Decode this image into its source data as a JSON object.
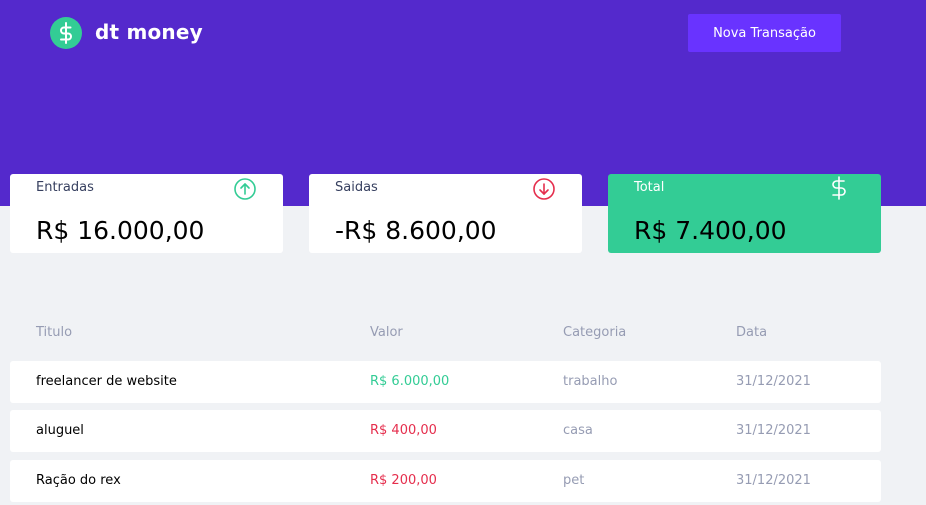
{
  "header": {
    "logo_icon": "dollar-sign-icon",
    "logo_text": "dt money",
    "new_transaction_label": "Nova Transação"
  },
  "summary": {
    "income": {
      "label": "Entradas",
      "value": "R$ 16.000,00",
      "icon": "arrow-up-circle-icon"
    },
    "outcome": {
      "label": "Saidas",
      "value": "-R$ 8.600,00",
      "icon": "arrow-down-circle-icon"
    },
    "total": {
      "label": "Total",
      "value": "R$ 7.400,00",
      "icon": "dollar-sign-icon"
    }
  },
  "table": {
    "headers": [
      "Titulo",
      "Valor",
      "Categoria",
      "Data"
    ],
    "rows": [
      {
        "title": "freelancer de website",
        "amount": "R$ 6.000,00",
        "type": "income",
        "category": "trabalho",
        "date": "31/12/2021"
      },
      {
        "title": "aluguel",
        "amount": "R$ 400,00",
        "type": "outcome",
        "category": "casa",
        "date": "31/12/2021"
      },
      {
        "title": "Ração do rex",
        "amount": "R$ 200,00",
        "type": "outcome",
        "category": "pet",
        "date": "31/12/2021"
      }
    ]
  },
  "colors": {
    "header_bg": "#5429cc",
    "button_bg": "#6933ff",
    "green": "#33cc95",
    "red": "#e52e4d",
    "page_bg": "#f0f2f5",
    "muted_text": "#969cb3"
  }
}
